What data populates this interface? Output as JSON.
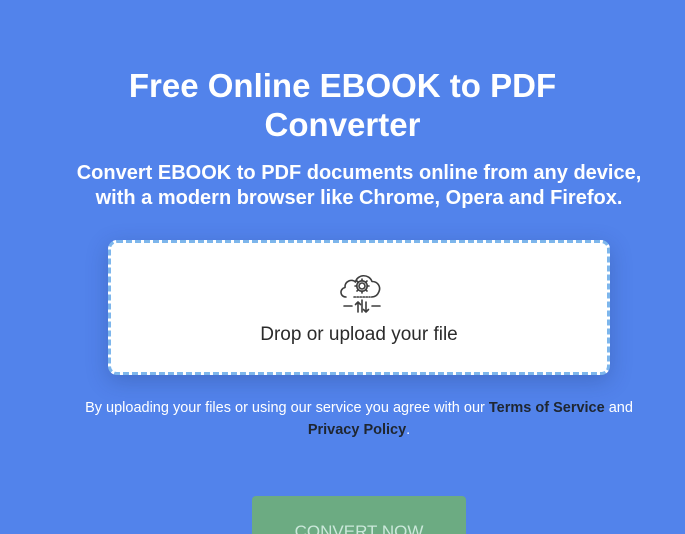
{
  "header": {
    "title_line1": "Free Online EBOOK to PDF",
    "title_line2": "Converter",
    "subtitle_line1": "Convert EBOOK to PDF documents online from any device,",
    "subtitle_line2": "with a modern browser like Chrome, Opera and Firefox."
  },
  "dropzone": {
    "label": "Drop or upload your file",
    "icon": "cloud-gear-upload-icon"
  },
  "terms": {
    "text_before": "By uploading your files or using our service you agree with our ",
    "terms_link": "Terms of Service",
    "text_middle": " and",
    "privacy_link": "Privacy Policy",
    "text_after": "."
  },
  "actions": {
    "convert_label": "CONVERT NOW"
  },
  "colors": {
    "background": "#5283eb",
    "dropzone_border": "#7db6ec",
    "convert_button": "#6cab82",
    "link_text": "#1f2630"
  }
}
